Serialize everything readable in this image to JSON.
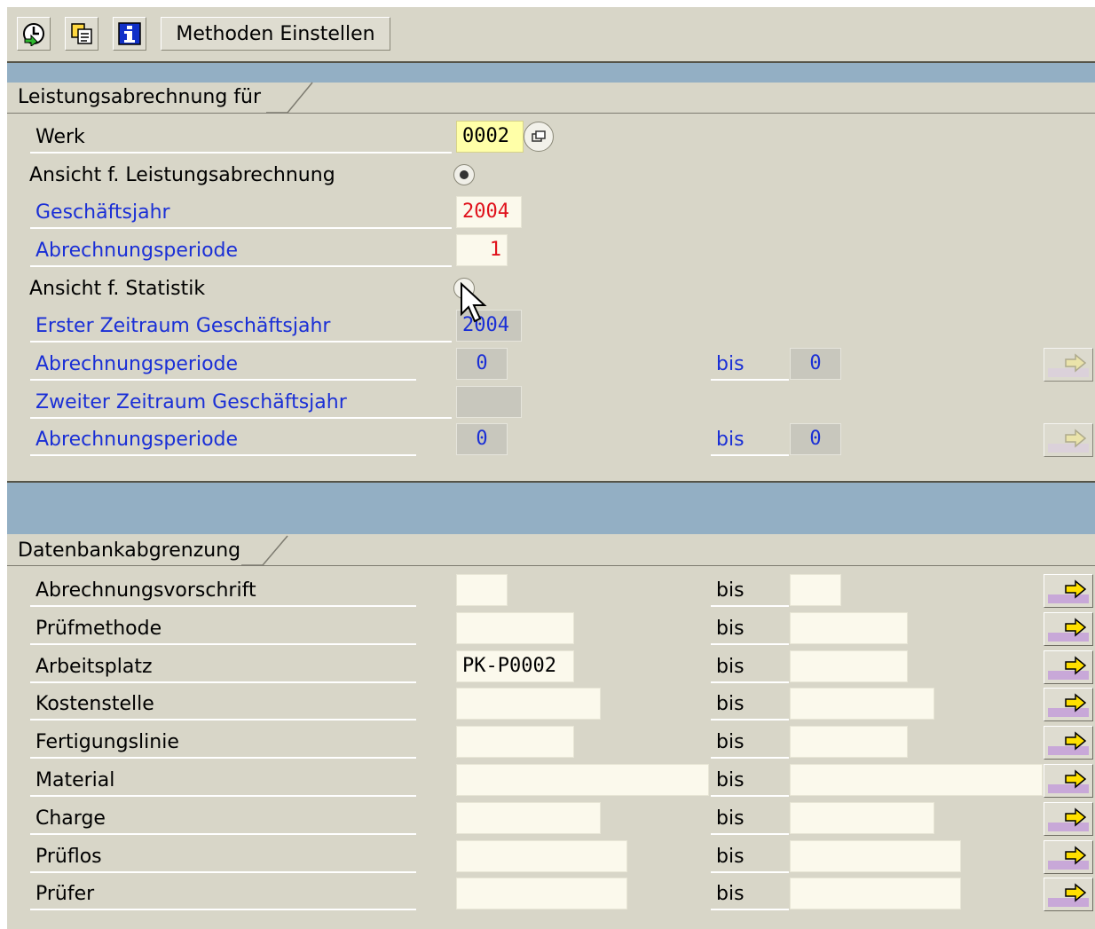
{
  "toolbar": {
    "methoden_label": "Methoden Einstellen"
  },
  "section1": {
    "title": "Leistungsabrechnung für",
    "werk_label": "Werk",
    "werk_value": "0002",
    "ansicht_leistung_label": "Ansicht f. Leistungsabrechnung",
    "geschaeftsjahr_label": "Geschäftsjahr",
    "geschaeftsjahr_value": "2004",
    "abrechnungsperiode_label": "Abrechnungsperiode",
    "abrechnungsperiode_value": "1",
    "ansicht_statistik_label": "Ansicht f. Statistik",
    "erster_zeitraum_label": "Erster Zeitraum Geschäftsjahr",
    "erster_zeitraum_value": "2004",
    "periode1_label": "Abrechnungsperiode",
    "periode1_from": "0",
    "periode1_bis": "bis",
    "periode1_to": "0",
    "zweiter_zeitraum_label": "Zweiter Zeitraum Geschäftsjahr",
    "zweiter_zeitraum_value": "",
    "periode2_label": "Abrechnungsperiode",
    "periode2_from": "0",
    "periode2_bis": "bis",
    "periode2_to": "0"
  },
  "section2": {
    "title": "Datenbankabgrenzung",
    "rows": [
      {
        "label": "Abrechnungsvorschrift",
        "from": "",
        "bis": "bis",
        "to": ""
      },
      {
        "label": "Prüfmethode",
        "from": "",
        "bis": "bis",
        "to": ""
      },
      {
        "label": "Arbeitsplatz",
        "from": "PK-P0002",
        "bis": "bis",
        "to": ""
      },
      {
        "label": "Kostenstelle",
        "from": "",
        "bis": "bis",
        "to": ""
      },
      {
        "label": "Fertigungslinie",
        "from": "",
        "bis": "bis",
        "to": ""
      },
      {
        "label": "Material",
        "from": "",
        "bis": "bis",
        "to": ""
      },
      {
        "label": "Charge",
        "from": "",
        "bis": "bis",
        "to": ""
      },
      {
        "label": "Prüflos",
        "from": "",
        "bis": "bis",
        "to": ""
      },
      {
        "label": "Prüfer",
        "from": "",
        "bis": "bis",
        "to": ""
      }
    ]
  },
  "colors": {
    "label_blue": "#1a2fd6",
    "value_red": "#e0121c",
    "strip_blue": "#93afc4",
    "panel_bg": "#d8d6c8"
  }
}
